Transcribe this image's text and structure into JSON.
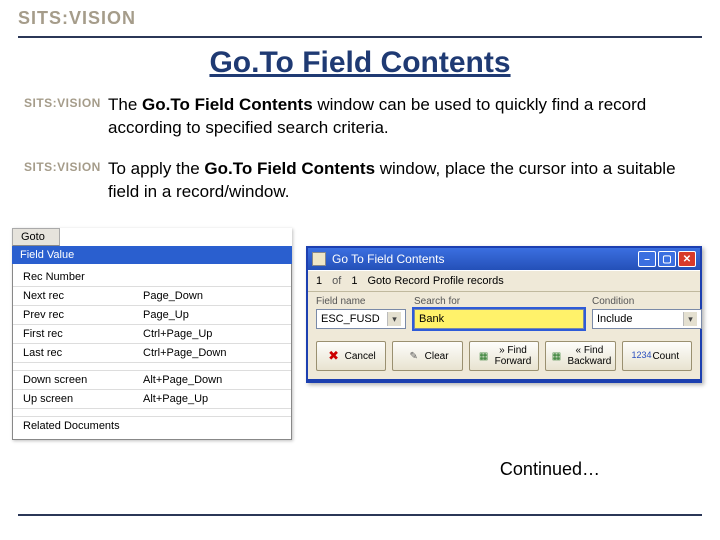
{
  "logo_text": "SITS:VISION",
  "page_title": "Go.To Field Contents",
  "bullets": {
    "b1_pre": "The ",
    "b1_bold": "Go.To Field Contents",
    "b1_post": " window can be used to quickly find a record according to specified search criteria.",
    "b2_pre": "To apply the ",
    "b2_bold": "Go.To Field Contents",
    "b2_post": " window, place the cursor into a suitable field in a record/window."
  },
  "menu": {
    "tab": "Goto",
    "header": "Field Value",
    "rows": [
      {
        "k": "Rec Number",
        "v": ""
      },
      {
        "k": "Next rec",
        "v": "Page_Down"
      },
      {
        "k": "Prev rec",
        "v": "Page_Up"
      },
      {
        "k": "First rec",
        "v": "Ctrl+Page_Up"
      },
      {
        "k": "Last rec",
        "v": "Ctrl+Page_Down"
      }
    ],
    "rows2": [
      {
        "k": "Down screen",
        "v": "Alt+Page_Down"
      },
      {
        "k": "Up screen",
        "v": "Alt+Page_Up"
      }
    ],
    "rows3": [
      {
        "k": "Related Documents",
        "v": ""
      }
    ]
  },
  "window": {
    "title": "Go To Field Contents",
    "nav": {
      "current": "1",
      "of_label": "of",
      "total": "1",
      "desc": "Goto Record Profile records"
    },
    "labels": {
      "field": "Field name",
      "search": "Search for",
      "cond": "Condition"
    },
    "fields": {
      "field_value": "ESC_FUSD",
      "search_value": "Bank",
      "cond_value": "Include"
    },
    "buttons": {
      "cancel": "Cancel",
      "clear": "Clear",
      "forward_a": "» Find",
      "forward_b": "Forward",
      "backward_a": "« Find",
      "backward_b": "Backward",
      "count": "Count"
    }
  },
  "continued": "Continued…"
}
